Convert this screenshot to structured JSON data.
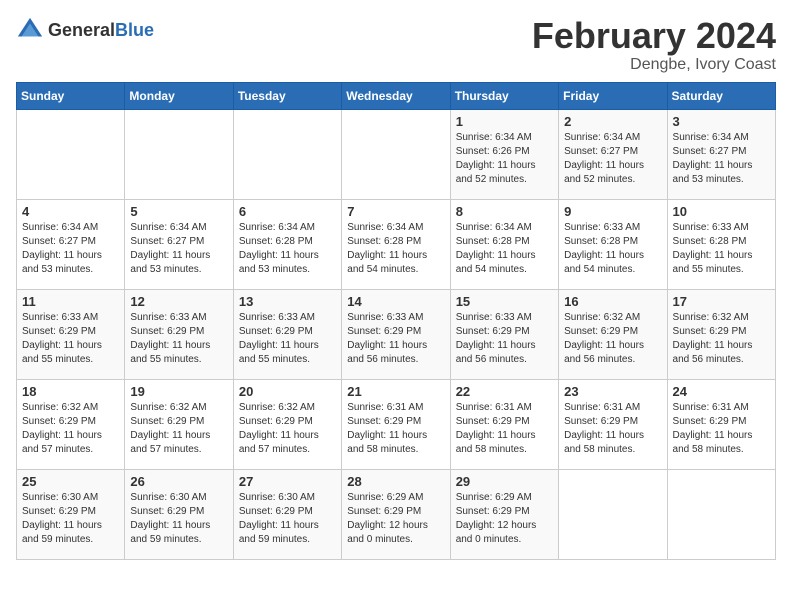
{
  "logo": {
    "general": "General",
    "blue": "Blue"
  },
  "title": {
    "month_year": "February 2024",
    "location": "Dengbe, Ivory Coast"
  },
  "headers": [
    "Sunday",
    "Monday",
    "Tuesday",
    "Wednesday",
    "Thursday",
    "Friday",
    "Saturday"
  ],
  "weeks": [
    [
      {
        "day": "",
        "info": ""
      },
      {
        "day": "",
        "info": ""
      },
      {
        "day": "",
        "info": ""
      },
      {
        "day": "",
        "info": ""
      },
      {
        "day": "1",
        "info": "Sunrise: 6:34 AM\nSunset: 6:26 PM\nDaylight: 11 hours\nand 52 minutes."
      },
      {
        "day": "2",
        "info": "Sunrise: 6:34 AM\nSunset: 6:27 PM\nDaylight: 11 hours\nand 52 minutes."
      },
      {
        "day": "3",
        "info": "Sunrise: 6:34 AM\nSunset: 6:27 PM\nDaylight: 11 hours\nand 53 minutes."
      }
    ],
    [
      {
        "day": "4",
        "info": "Sunrise: 6:34 AM\nSunset: 6:27 PM\nDaylight: 11 hours\nand 53 minutes."
      },
      {
        "day": "5",
        "info": "Sunrise: 6:34 AM\nSunset: 6:27 PM\nDaylight: 11 hours\nand 53 minutes."
      },
      {
        "day": "6",
        "info": "Sunrise: 6:34 AM\nSunset: 6:28 PM\nDaylight: 11 hours\nand 53 minutes."
      },
      {
        "day": "7",
        "info": "Sunrise: 6:34 AM\nSunset: 6:28 PM\nDaylight: 11 hours\nand 54 minutes."
      },
      {
        "day": "8",
        "info": "Sunrise: 6:34 AM\nSunset: 6:28 PM\nDaylight: 11 hours\nand 54 minutes."
      },
      {
        "day": "9",
        "info": "Sunrise: 6:33 AM\nSunset: 6:28 PM\nDaylight: 11 hours\nand 54 minutes."
      },
      {
        "day": "10",
        "info": "Sunrise: 6:33 AM\nSunset: 6:28 PM\nDaylight: 11 hours\nand 55 minutes."
      }
    ],
    [
      {
        "day": "11",
        "info": "Sunrise: 6:33 AM\nSunset: 6:29 PM\nDaylight: 11 hours\nand 55 minutes."
      },
      {
        "day": "12",
        "info": "Sunrise: 6:33 AM\nSunset: 6:29 PM\nDaylight: 11 hours\nand 55 minutes."
      },
      {
        "day": "13",
        "info": "Sunrise: 6:33 AM\nSunset: 6:29 PM\nDaylight: 11 hours\nand 55 minutes."
      },
      {
        "day": "14",
        "info": "Sunrise: 6:33 AM\nSunset: 6:29 PM\nDaylight: 11 hours\nand 56 minutes."
      },
      {
        "day": "15",
        "info": "Sunrise: 6:33 AM\nSunset: 6:29 PM\nDaylight: 11 hours\nand 56 minutes."
      },
      {
        "day": "16",
        "info": "Sunrise: 6:32 AM\nSunset: 6:29 PM\nDaylight: 11 hours\nand 56 minutes."
      },
      {
        "day": "17",
        "info": "Sunrise: 6:32 AM\nSunset: 6:29 PM\nDaylight: 11 hours\nand 56 minutes."
      }
    ],
    [
      {
        "day": "18",
        "info": "Sunrise: 6:32 AM\nSunset: 6:29 PM\nDaylight: 11 hours\nand 57 minutes."
      },
      {
        "day": "19",
        "info": "Sunrise: 6:32 AM\nSunset: 6:29 PM\nDaylight: 11 hours\nand 57 minutes."
      },
      {
        "day": "20",
        "info": "Sunrise: 6:32 AM\nSunset: 6:29 PM\nDaylight: 11 hours\nand 57 minutes."
      },
      {
        "day": "21",
        "info": "Sunrise: 6:31 AM\nSunset: 6:29 PM\nDaylight: 11 hours\nand 58 minutes."
      },
      {
        "day": "22",
        "info": "Sunrise: 6:31 AM\nSunset: 6:29 PM\nDaylight: 11 hours\nand 58 minutes."
      },
      {
        "day": "23",
        "info": "Sunrise: 6:31 AM\nSunset: 6:29 PM\nDaylight: 11 hours\nand 58 minutes."
      },
      {
        "day": "24",
        "info": "Sunrise: 6:31 AM\nSunset: 6:29 PM\nDaylight: 11 hours\nand 58 minutes."
      }
    ],
    [
      {
        "day": "25",
        "info": "Sunrise: 6:30 AM\nSunset: 6:29 PM\nDaylight: 11 hours\nand 59 minutes."
      },
      {
        "day": "26",
        "info": "Sunrise: 6:30 AM\nSunset: 6:29 PM\nDaylight: 11 hours\nand 59 minutes."
      },
      {
        "day": "27",
        "info": "Sunrise: 6:30 AM\nSunset: 6:29 PM\nDaylight: 11 hours\nand 59 minutes."
      },
      {
        "day": "28",
        "info": "Sunrise: 6:29 AM\nSunset: 6:29 PM\nDaylight: 12 hours\nand 0 minutes."
      },
      {
        "day": "29",
        "info": "Sunrise: 6:29 AM\nSunset: 6:29 PM\nDaylight: 12 hours\nand 0 minutes."
      },
      {
        "day": "",
        "info": ""
      },
      {
        "day": "",
        "info": ""
      }
    ]
  ]
}
